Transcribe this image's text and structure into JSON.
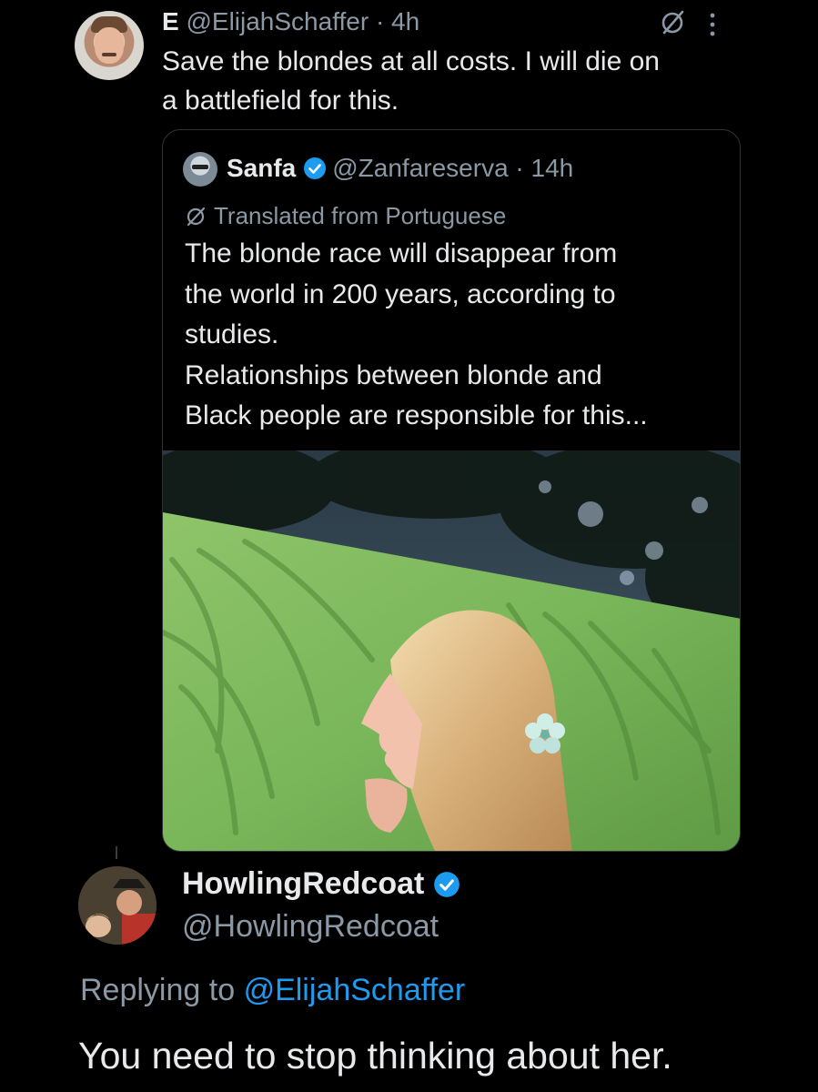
{
  "tweet": {
    "display_name": "E",
    "handle": "@ElijahSchaffer",
    "separator": "·",
    "time": "4h",
    "text_line1": "Save the blondes at all costs. I will die on",
    "text_line2": "a battlefield for this.",
    "icons": [
      "grok-icon",
      "more-options-icon"
    ]
  },
  "quote": {
    "display_name": "Sanfa",
    "handle": "@Zanfareserva",
    "separator": "·",
    "time": "14h",
    "translated_label": "Translated from Portuguese",
    "text_lines": [
      "The blonde race will disappear from",
      "the world in 200 years, according to",
      "studies.",
      "Relationships between blonde and",
      "Black people are responsible for this..."
    ],
    "media": "photo of a blonde woman in profile with a flower in her hair in front of a green wall with palm shadows"
  },
  "reply": {
    "display_name": "HowlingRedcoat",
    "handle": "@HowlingRedcoat",
    "replying_prefix": "Replying to",
    "replying_to": "@ElijahSchaffer",
    "text": "You need to stop thinking about her."
  },
  "colors": {
    "background": "#000000",
    "text_primary": "#e7e9ea",
    "text_secondary": "#8b98a5",
    "accent": "#1d9bf0",
    "border": "#2f3336"
  }
}
